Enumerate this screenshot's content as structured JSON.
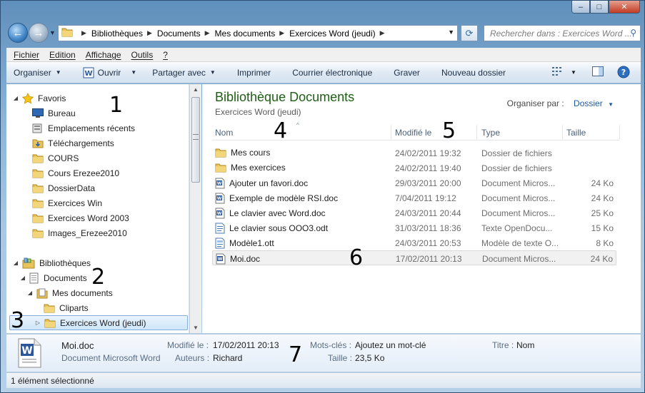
{
  "window": {
    "minimize": "–",
    "maximize": "□",
    "close": "✕"
  },
  "address": {
    "crumbs": [
      "Bibliothèques",
      "Documents",
      "Mes documents",
      "Exercices Word (jeudi)"
    ],
    "search_placeholder": "Rechercher dans : Exercices Word ..."
  },
  "menu": [
    "Fichier",
    "Edition",
    "Affichage",
    "Outils",
    "?"
  ],
  "toolbar": {
    "organize": "Organiser",
    "open": "Ouvrir",
    "share": "Partager avec",
    "print": "Imprimer",
    "email": "Courrier électronique",
    "burn": "Graver",
    "new_folder": "Nouveau dossier"
  },
  "nav": {
    "favorites": "Favoris",
    "fav_items": [
      "Bureau",
      "Emplacements récents",
      "Téléchargements",
      "COURS",
      "Cours Erezee2010",
      "DossierData",
      "Exercices Win",
      "Exercices Word 2003",
      "Images_Erezee2010"
    ],
    "libraries": "Bibliothèques",
    "documents": "Documents",
    "mes_documents": "Mes documents",
    "cliparts": "Cliparts",
    "exercices_word": "Exercices Word (jeudi)"
  },
  "content": {
    "title": "Bibliothèque Documents",
    "subtitle": "Exercices Word (jeudi)",
    "arrange_label": "Organiser par :",
    "arrange_value": "Dossier",
    "columns": {
      "name": "Nom",
      "modified": "Modifié le",
      "type": "Type",
      "size": "Taille"
    },
    "files": [
      {
        "name": "Mes cours",
        "date": "24/02/2011 19:32",
        "type": "Dossier de fichiers",
        "size": "",
        "icon": "folder-icon"
      },
      {
        "name": "Mes exercices",
        "date": "24/02/2011 19:40",
        "type": "Dossier de fichiers",
        "size": "",
        "icon": "folder-icon"
      },
      {
        "name": "Ajouter un favori.doc",
        "date": "29/03/2011 20:00",
        "type": "Document Micros...",
        "size": "24 Ko",
        "icon": "word-doc-icon"
      },
      {
        "name": "Exemple de modèle RSI.doc",
        "date": "7/04/2011 19:12",
        "type": "Document Micros...",
        "size": "24 Ko",
        "icon": "word-doc-icon"
      },
      {
        "name": "Le clavier avec Word.doc",
        "date": "24/03/2011 20:44",
        "type": "Document Micros...",
        "size": "25 Ko",
        "icon": "word-doc-icon"
      },
      {
        "name": "Le clavier sous OOO3.odt",
        "date": "31/03/2011 18:36",
        "type": "Texte OpenDocu...",
        "size": "15 Ko",
        "icon": "odt-doc-icon"
      },
      {
        "name": "Modèle1.ott",
        "date": "24/03/2011 20:53",
        "type": "Modèle de texte O...",
        "size": "8 Ko",
        "icon": "ott-template-icon"
      },
      {
        "name": "Moi.doc",
        "date": "17/02/2011 20:13",
        "type": "Document Micros...",
        "size": "24 Ko",
        "icon": "word-doc-icon"
      }
    ]
  },
  "details": {
    "filename": "Moi.doc",
    "filetype": "Document Microsoft Word",
    "modified_label": "Modifié le :",
    "modified_value": "17/02/2011 20:13",
    "authors_label": "Auteurs :",
    "authors_value": "Richard",
    "keywords_label": "Mots-clés :",
    "keywords_value": "Ajoutez un mot-clé",
    "size_label": "Taille :",
    "size_value": "23,5 Ko",
    "title_label": "Titre :",
    "title_value": "Nom"
  },
  "status": "1 élément sélectionné",
  "annotations": [
    "1",
    "2",
    "3",
    "4",
    "5",
    "6",
    "7"
  ]
}
